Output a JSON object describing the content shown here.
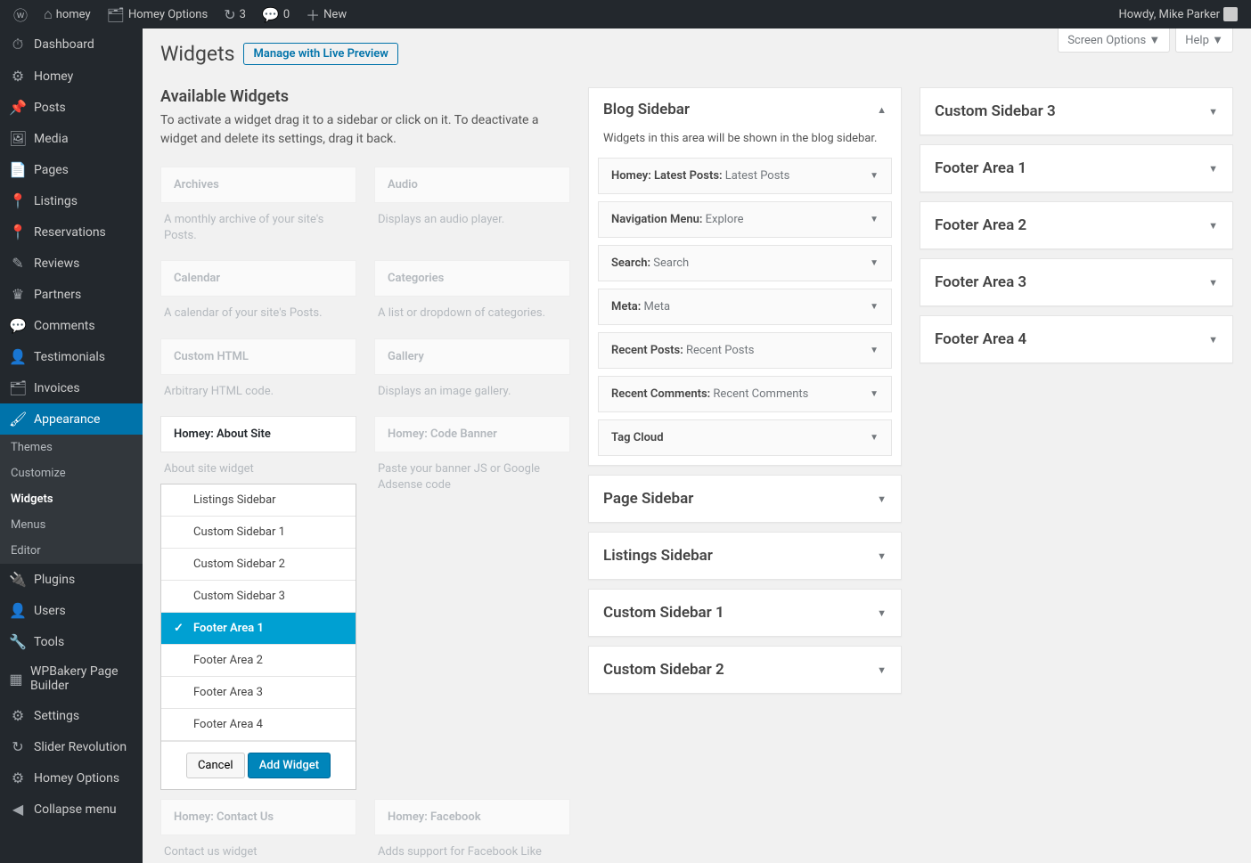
{
  "toolbar": {
    "site": "homey",
    "options": "Homey Options",
    "updates": "3",
    "comments": "0",
    "new": "New",
    "howdy": "Howdy, Mike Parker"
  },
  "page": {
    "title": "Widgets",
    "preview_btn": "Manage with Live Preview",
    "screen_options": "Screen Options",
    "help": "Help"
  },
  "sidebar": {
    "items": [
      {
        "label": "Dashboard",
        "ico": "⏱"
      },
      {
        "label": "Homey",
        "ico": "⚙"
      },
      {
        "label": "Posts",
        "ico": "📌"
      },
      {
        "label": "Media",
        "ico": "🖼"
      },
      {
        "label": "Pages",
        "ico": "📄"
      },
      {
        "label": "Listings",
        "ico": "📍"
      },
      {
        "label": "Reservations",
        "ico": "📍"
      },
      {
        "label": "Reviews",
        "ico": "✎"
      },
      {
        "label": "Partners",
        "ico": "♛"
      },
      {
        "label": "Comments",
        "ico": "💬"
      },
      {
        "label": "Testimonials",
        "ico": "👤"
      },
      {
        "label": "Invoices",
        "ico": "🗂"
      }
    ],
    "appearance": "Appearance",
    "sub": [
      "Themes",
      "Customize",
      "Widgets",
      "Menus",
      "Editor"
    ],
    "items2": [
      {
        "label": "Plugins",
        "ico": "🔌"
      },
      {
        "label": "Users",
        "ico": "👤"
      },
      {
        "label": "Tools",
        "ico": "🔧"
      },
      {
        "label": "WPBakery Page Builder",
        "ico": "▦"
      },
      {
        "label": "Settings",
        "ico": "⚙"
      },
      {
        "label": "Slider Revolution",
        "ico": "↻"
      },
      {
        "label": "Homey Options",
        "ico": "⚙"
      },
      {
        "label": "Collapse menu",
        "ico": "◀"
      }
    ]
  },
  "available": {
    "heading": "Available Widgets",
    "desc": "To activate a widget drag it to a sidebar or click on it. To deactivate a widget and delete its settings, drag it back.",
    "widgets": [
      {
        "title": "Archives",
        "desc": "A monthly archive of your site's Posts."
      },
      {
        "title": "Audio",
        "desc": "Displays an audio player."
      },
      {
        "title": "Calendar",
        "desc": "A calendar of your site's Posts."
      },
      {
        "title": "Categories",
        "desc": "A list or dropdown of categories."
      },
      {
        "title": "Custom HTML",
        "desc": "Arbitrary HTML code."
      },
      {
        "title": "Gallery",
        "desc": "Displays an image gallery."
      },
      {
        "title": "Homey: About Site",
        "desc": "About site widget",
        "open": true
      },
      {
        "title": "Homey: Code Banner",
        "desc": "Paste your banner JS or Google Adsense code"
      },
      {
        "title": "Homey: Contact Us",
        "desc": "Contact us widget"
      },
      {
        "title": "Homey: Facebook",
        "desc": "Adds support for Facebook Like"
      }
    ],
    "chooser": {
      "items": [
        "Listings Sidebar",
        "Custom Sidebar 1",
        "Custom Sidebar 2",
        "Custom Sidebar 3",
        "Footer Area 1",
        "Footer Area 2",
        "Footer Area 3",
        "Footer Area 4"
      ],
      "selected": "Footer Area 1",
      "cancel": "Cancel",
      "add": "Add Widget"
    }
  },
  "blogSidebar": {
    "title": "Blog Sidebar",
    "desc": "Widgets in this area will be shown in the blog sidebar.",
    "widgets": [
      {
        "name": "Homey: Latest Posts:",
        "sub": "Latest Posts"
      },
      {
        "name": "Navigation Menu:",
        "sub": "Explore"
      },
      {
        "name": "Search:",
        "sub": "Search"
      },
      {
        "name": "Meta:",
        "sub": "Meta"
      },
      {
        "name": "Recent Posts:",
        "sub": "Recent Posts"
      },
      {
        "name": "Recent Comments:",
        "sub": "Recent Comments"
      },
      {
        "name": "Tag Cloud",
        "sub": ""
      }
    ]
  },
  "leftAreas": [
    "Page Sidebar",
    "Listings Sidebar",
    "Custom Sidebar 1",
    "Custom Sidebar 2"
  ],
  "rightAreas": [
    "Custom Sidebar 3",
    "Footer Area 1",
    "Footer Area 2",
    "Footer Area 3",
    "Footer Area 4"
  ]
}
